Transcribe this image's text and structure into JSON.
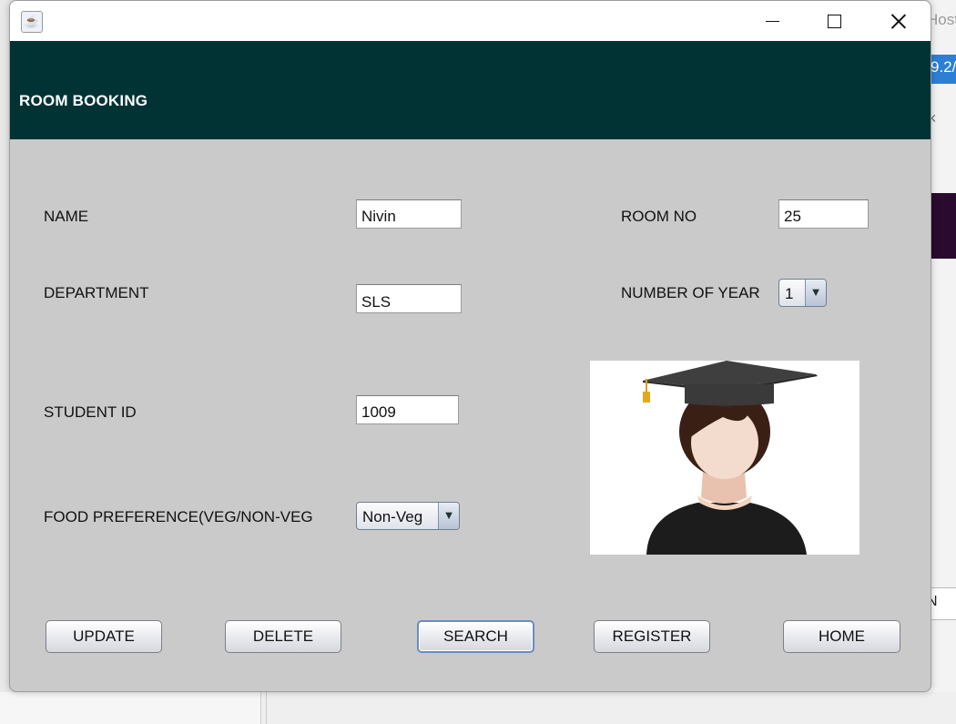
{
  "background": {
    "host_text": "Host",
    "ip_text": "9.2/",
    "close_glyph": "×",
    "field_text": "N"
  },
  "window": {
    "app_icon": "java-icon",
    "controls": [
      "minimize-icon",
      "maximize-icon",
      "close-icon"
    ]
  },
  "header": {
    "title": "ROOM BOOKING",
    "background_color": "#013334"
  },
  "form": {
    "name_label": "NAME",
    "name_value": "Nivin",
    "department_label": "DEPARTMENT",
    "department_value": "SLS",
    "student_id_label": "STUDENT ID",
    "student_id_value": "1009",
    "food_label": "FOOD PREFERENCE(VEG/NON-VEG",
    "food_value": "Non-Veg",
    "room_no_label": "ROOM NO",
    "room_no_value": "25",
    "year_label": "NUMBER OF YEAR",
    "year_value": "1"
  },
  "photo": {
    "icon": "graduate-avatar-icon"
  },
  "buttons": {
    "update": "UPDATE",
    "delete": "DELETE",
    "search": "SEARCH",
    "register": "REGISTER",
    "home": "HOME"
  }
}
